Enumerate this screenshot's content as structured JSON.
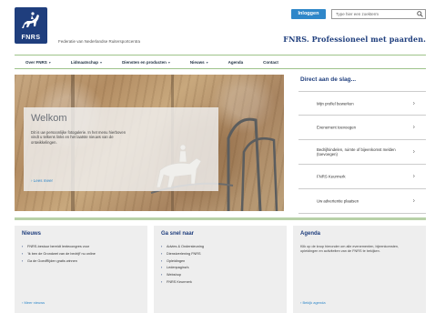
{
  "header": {
    "logo_text": "FNRS",
    "tagline": "Federatie van Nederlandse Ruitersportcentra",
    "login_label": "Inloggen",
    "search_placeholder": "Type hier een zoekterm",
    "slogan": "FNRS. Professioneel met paarden."
  },
  "nav": {
    "items": [
      {
        "label": "Over FNRS",
        "caret": "▾"
      },
      {
        "label": "Lidmaatschap",
        "caret": "▾"
      },
      {
        "label": "Diensten en producten",
        "caret": "▾"
      },
      {
        "label": "Nieuws",
        "caret": "▾"
      },
      {
        "label": "Agenda",
        "caret": ""
      },
      {
        "label": "Contact",
        "caret": ""
      }
    ]
  },
  "hero": {
    "title": "Welkom",
    "text": "Dit is uw persoonlijke fotogalerie. In het menu hierboven vindt u telkens links en het laatste nieuws van de ontwikkelingen.",
    "more_label": "› Lees meer"
  },
  "direct": {
    "title": "Direct aan de slag...",
    "items": [
      {
        "label": "Mijn profiel bewerken"
      },
      {
        "label": "Evenement toevoegen"
      },
      {
        "label": "Bedrijfsindelen, ruimte of bijeenkomst melden (toevoegen)"
      },
      {
        "label": "FNRS Keurmerk"
      },
      {
        "label": "Uw advertentie plaatsen"
      }
    ]
  },
  "columns": {
    "nieuws": {
      "title": "Nieuws",
      "items": [
        "FNRS-bestuur bereidt lentecongres voor",
        "'Ik ben de Grondwet van de bedrijf' nu online",
        "Ga de GoedRijden gratis winnen"
      ],
      "more_label": "› Meer nieuws"
    },
    "ga_naar": {
      "title": "Ga snel naar",
      "items": [
        "Advies & Ondersteuning",
        "Dienstverlening FNRS",
        "Opleidingen",
        "Ledenpagina's",
        "Webshop",
        "FNRS Keurmerk"
      ]
    },
    "agenda": {
      "title": "Agenda",
      "text": "Klik op de knop hieronder om alle evenementen, bijeenkomsten, opleidingen en activiteiten van de FNRS te bekijken.",
      "more_label": "› Bekijk agenda"
    }
  },
  "colors": {
    "brand_blue": "#1f3e7d",
    "accent_blue": "#2f87c9",
    "nav_green": "#9ec38a"
  }
}
